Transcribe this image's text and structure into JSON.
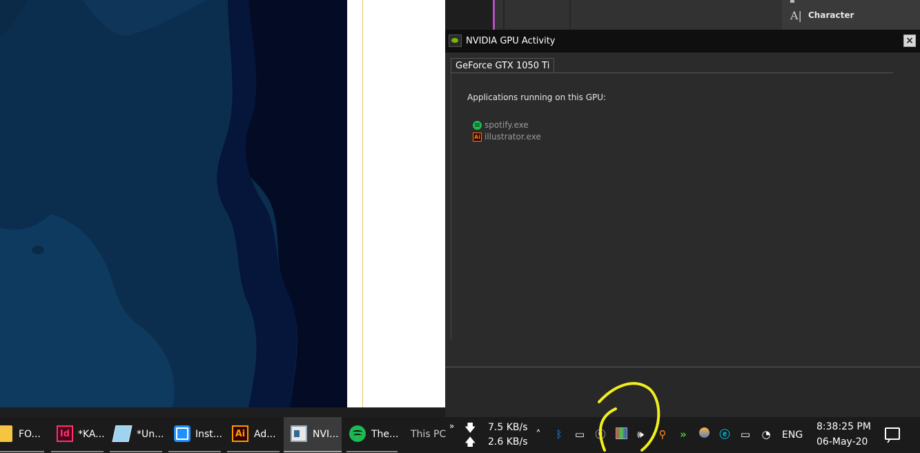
{
  "nvidia_window": {
    "title": "NVIDIA GPU Activity",
    "close_glyph": "×",
    "tab": "GeForce GTX 1050 Ti",
    "apps_label": "Applications running on this GPU:",
    "apps": [
      {
        "name": "spotify.exe"
      },
      {
        "name": "illustrator.exe"
      }
    ]
  },
  "illustrator_panel": {
    "character_label": "Character",
    "character_icon": "A|"
  },
  "taskbar": {
    "items": [
      {
        "label": "FO...",
        "icon": "folder-icon",
        "color": "#f5c542"
      },
      {
        "label": "*KA...",
        "icon": "Id",
        "color": "#ff3366"
      },
      {
        "label": "*Un...",
        "icon": "notepad-icon",
        "color": "#9fd3f0"
      },
      {
        "label": "Inst...",
        "icon": "instagram-icon",
        "color": "#1e90ff"
      },
      {
        "label": "Ad...",
        "icon": "Ai",
        "color": "#ff9a00"
      },
      {
        "label": "NVI...",
        "icon": "nvidia-window-icon",
        "color": "#76b900"
      },
      {
        "label": "The...",
        "icon": "spotify-icon",
        "color": "#1db954"
      }
    ],
    "this_pc": "This PC",
    "net_down": "7.5 KB/s",
    "net_up": "2.6 KB/s",
    "language": "ENG",
    "time": "8:38:25 PM",
    "date": "06-May-20"
  },
  "colors": {
    "nvidia_green": "#76b900",
    "annotation_yellow": "#f2ef1c"
  }
}
